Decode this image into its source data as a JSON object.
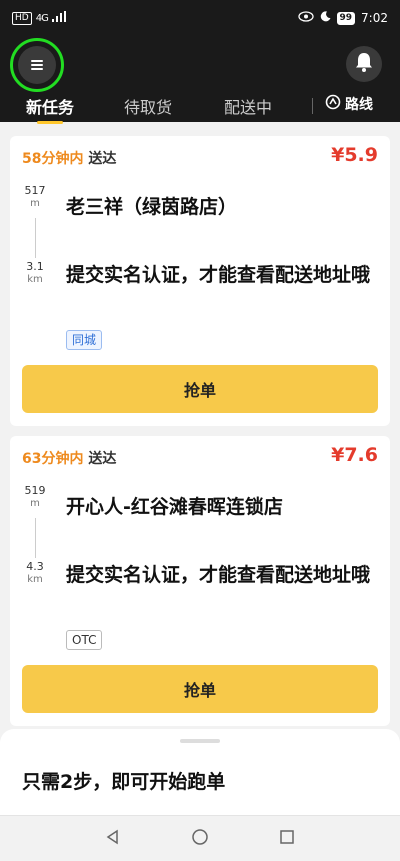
{
  "status_bar": {
    "left_badge": "HD",
    "network": "4G",
    "battery": "99",
    "time": "7:02"
  },
  "header": {
    "tabs": [
      {
        "label": "新任务",
        "active": true
      },
      {
        "label": "待取货",
        "active": false
      },
      {
        "label": "配送中",
        "active": false
      }
    ],
    "route_label": "路线"
  },
  "orders": [
    {
      "eta_minutes": "58分钟内",
      "eta_suffix": "送达",
      "price": "¥5.9",
      "pickup_distance_value": "517",
      "pickup_distance_unit": "m",
      "delivery_distance_value": "3.1",
      "delivery_distance_unit": "km",
      "shop_name": "老三祥（绿茵路店）",
      "address_note": "提交实名认证，才能查看配送地址哦",
      "tag": "同城",
      "grab_label": "抢单"
    },
    {
      "eta_minutes": "63分钟内",
      "eta_suffix": "送达",
      "price": "¥7.6",
      "pickup_distance_value": "519",
      "pickup_distance_unit": "m",
      "delivery_distance_value": "4.3",
      "delivery_distance_unit": "km",
      "shop_name": "开心人-红谷滩春晖连锁店",
      "address_note": "提交实名认证，才能查看配送地址哦",
      "tag": "OTC",
      "grab_label": "抢单"
    }
  ],
  "bottom_sheet": {
    "title": "只需2步，即可开始跑单"
  },
  "colors": {
    "header_bg": "#1a1a1a",
    "accent_yellow": "#f7c94a",
    "eta_orange": "#ee8a1e",
    "price_red": "#e43b2c",
    "highlight_green": "#22dd22"
  }
}
